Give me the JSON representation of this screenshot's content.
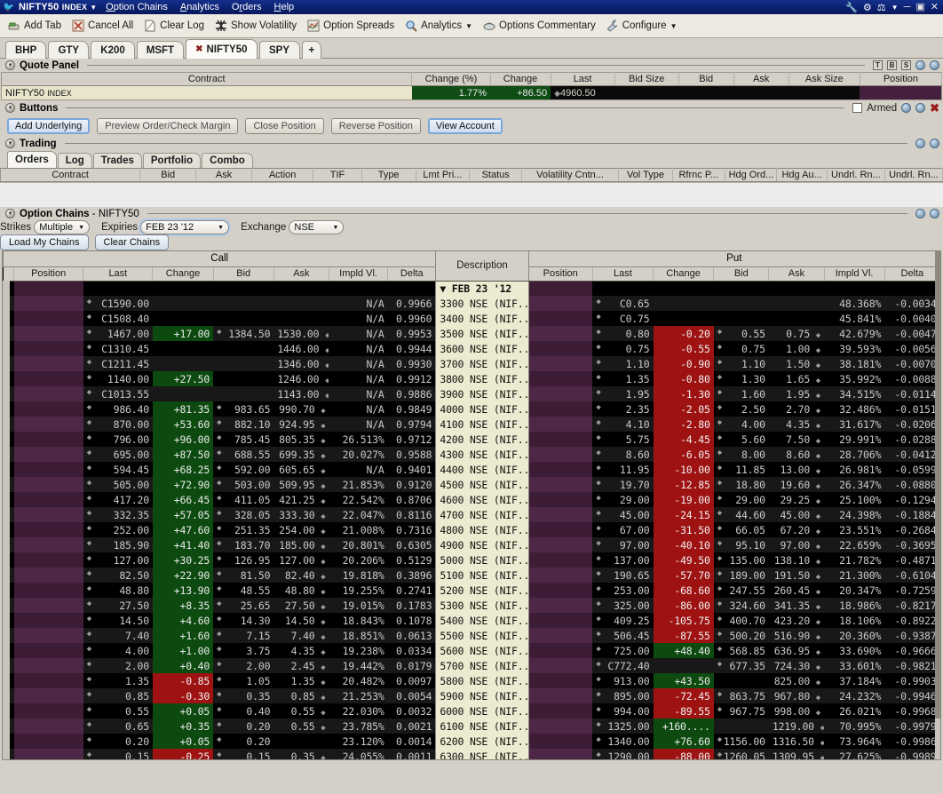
{
  "window": {
    "title_main": "NIFTY50",
    "title_sub": "INDEX",
    "app_icon": "bird-icon",
    "menu": [
      "Option Chains",
      "Analytics",
      "Orders",
      "Help"
    ],
    "right_icons": [
      "wrench-icon",
      "network-icon",
      "pin-icon",
      "chevron-down-icon"
    ],
    "controls": [
      "minimize-button",
      "maximize-button",
      "close-button"
    ]
  },
  "toolbar": {
    "items": [
      {
        "label": "Add Tab",
        "icon": "add-tab-icon"
      },
      {
        "label": "Cancel All",
        "icon": "cancel-all-icon"
      },
      {
        "label": "Clear Log",
        "icon": "clear-log-icon"
      },
      {
        "label": "Show Volatility",
        "icon": "volatility-icon"
      },
      {
        "label": "Option Spreads",
        "icon": "option-spreads-icon"
      },
      {
        "label": "Analytics",
        "icon": "magnifier-icon",
        "dropdown": "▼"
      },
      {
        "label": "Options Commentary",
        "icon": "commentary-icon"
      },
      {
        "label": "Configure",
        "icon": "wrench-icon",
        "dropdown": "▼"
      }
    ]
  },
  "tabs": {
    "items": [
      {
        "label": "BHP",
        "active": false,
        "closable": false
      },
      {
        "label": "GTY",
        "active": false,
        "closable": false
      },
      {
        "label": "K200",
        "active": false,
        "closable": false
      },
      {
        "label": "MSFT",
        "active": false,
        "closable": false
      },
      {
        "label": "NIFTY50",
        "active": true,
        "closable": true,
        "close_glyph": "✖"
      },
      {
        "label": "SPY",
        "active": false,
        "closable": false
      }
    ],
    "add_label": "+"
  },
  "quote_panel": {
    "title": "Quote Panel",
    "right_buttons": [
      "T",
      "B",
      "S"
    ],
    "columns": [
      "Contract",
      "Change (%)",
      "Change",
      "Last",
      "Bid Size",
      "Bid",
      "Ask",
      "Ask Size",
      "Position"
    ],
    "row": {
      "contract": "NIFTY50",
      "contract_suffix": "INDEX",
      "change_pct": "1.77%",
      "change": "+86.50",
      "last": "4960.50",
      "bid_size": "",
      "bid": "",
      "ask": "",
      "ask_size": "",
      "position": ""
    }
  },
  "buttons_panel": {
    "title": "Buttons",
    "buttons": [
      {
        "label": "Add Underlying",
        "state": "focused"
      },
      {
        "label": "Preview Order/Check Margin",
        "state": "disabled"
      },
      {
        "label": "Close Position",
        "state": "disabled"
      },
      {
        "label": "Reverse Position",
        "state": "disabled"
      },
      {
        "label": "View Account",
        "state": "focused"
      }
    ],
    "armed_label": "Armed",
    "armed_checked": false
  },
  "trading_panel": {
    "title": "Trading",
    "tabs": [
      {
        "label": "Orders",
        "active": true
      },
      {
        "label": "Log",
        "active": false
      },
      {
        "label": "Trades",
        "active": false
      },
      {
        "label": "Portfolio",
        "active": false
      },
      {
        "label": "Combo",
        "active": false
      }
    ],
    "columns": [
      "Contract",
      "Bid",
      "Ask",
      "Action",
      "TIF",
      "Type",
      "Lmt Pri...",
      "Status",
      "Volatility Cntn...",
      "Vol Type",
      "Rfrnc P...",
      "Hdg Ord...",
      "Hdg Au...",
      "Undrl. Rn...",
      "Undrl. Rn..."
    ],
    "rows": []
  },
  "option_chains": {
    "title": "Option Chains",
    "title_suffix": "- NIFTY50",
    "controls": {
      "strikes_label": "Strikes",
      "strikes_value": "Multiple",
      "expiries_label": "Expiries",
      "expiries_value": "FEB 23 '12",
      "exchange_label": "Exchange",
      "exchange_value": "NSE",
      "load_chains_label": "Load My Chains",
      "clear_chains_label": "Clear Chains"
    },
    "group_headers": {
      "call": "Call",
      "description": "Description",
      "put": "Put"
    },
    "columns": [
      "Position",
      "Last",
      "Change",
      "Bid",
      "Ask",
      "Impld Vl.",
      "Delta"
    ],
    "expiry_group_row": "FEB 23 '12",
    "rows": [
      {
        "desc": "3300 NSE (NIF...",
        "call": {
          "pos": "",
          "last": "C1590.00",
          "change": "",
          "bid": "",
          "ask": "",
          "iv": "N/A",
          "delta": "0.9966"
        },
        "put": {
          "pos": "",
          "last": "C0.65",
          "change": "",
          "bid": "",
          "ask": "",
          "iv": "48.368%",
          "delta": "-0.0034"
        }
      },
      {
        "desc": "3400 NSE (NIF...",
        "call": {
          "pos": "",
          "last": "C1508.40",
          "change": "",
          "bid": "",
          "ask": "",
          "iv": "N/A",
          "delta": "0.9960"
        },
        "put": {
          "pos": "",
          "last": "C0.75",
          "change": "",
          "bid": "",
          "ask": "",
          "iv": "45.841%",
          "delta": "-0.0040"
        }
      },
      {
        "desc": "3500 NSE (NIF...",
        "call": {
          "pos": "",
          "last": "1467.00",
          "change": "+17.00",
          "bid": "1384.50",
          "ask": "1530.00",
          "iv": "N/A",
          "delta": "0.9953"
        },
        "put": {
          "pos": "",
          "last": "0.80",
          "change": "-0.20",
          "bid": "0.55",
          "ask": "0.75",
          "iv": "42.679%",
          "delta": "-0.0047"
        }
      },
      {
        "desc": "3600 NSE (NIF...",
        "call": {
          "pos": "",
          "last": "C1310.45",
          "change": "",
          "bid": "",
          "ask": "1446.00",
          "iv": "N/A",
          "delta": "0.9944"
        },
        "put": {
          "pos": "",
          "last": "0.75",
          "change": "-0.55",
          "bid": "0.75",
          "ask": "1.00",
          "iv": "39.593%",
          "delta": "-0.0056"
        }
      },
      {
        "desc": "3700 NSE (NIF...",
        "call": {
          "pos": "",
          "last": "C1211.45",
          "change": "",
          "bid": "",
          "ask": "1346.00",
          "iv": "N/A",
          "delta": "0.9930"
        },
        "put": {
          "pos": "",
          "last": "1.10",
          "change": "-0.90",
          "bid": "1.10",
          "ask": "1.50",
          "iv": "38.181%",
          "delta": "-0.0070"
        }
      },
      {
        "desc": "3800 NSE (NIF...",
        "call": {
          "pos": "",
          "last": "1140.00",
          "change": "+27.50",
          "bid": "",
          "ask": "1246.00",
          "iv": "N/A",
          "delta": "0.9912"
        },
        "put": {
          "pos": "",
          "last": "1.35",
          "change": "-0.80",
          "bid": "1.30",
          "ask": "1.65",
          "iv": "35.992%",
          "delta": "-0.0088"
        }
      },
      {
        "desc": "3900 NSE (NIF...",
        "call": {
          "pos": "",
          "last": "C1013.55",
          "change": "",
          "bid": "",
          "ask": "1143.00",
          "iv": "N/A",
          "delta": "0.9886"
        },
        "put": {
          "pos": "",
          "last": "1.95",
          "change": "-1.30",
          "bid": "1.60",
          "ask": "1.95",
          "iv": "34.515%",
          "delta": "-0.0114"
        }
      },
      {
        "desc": "4000 NSE (NIF...",
        "call": {
          "pos": "",
          "last": "986.40",
          "change": "+81.35",
          "bid": "983.65",
          "ask": "990.70",
          "iv": "N/A",
          "delta": "0.9849"
        },
        "put": {
          "pos": "",
          "last": "2.35",
          "change": "-2.05",
          "bid": "2.50",
          "ask": "2.70",
          "iv": "32.486%",
          "delta": "-0.0151"
        }
      },
      {
        "desc": "4100 NSE (NIF...",
        "call": {
          "pos": "",
          "last": "870.00",
          "change": "+53.60",
          "bid": "882.10",
          "ask": "924.95",
          "iv": "N/A",
          "delta": "0.9794"
        },
        "put": {
          "pos": "",
          "last": "4.10",
          "change": "-2.80",
          "bid": "4.00",
          "ask": "4.35",
          "iv": "31.617%",
          "delta": "-0.0206"
        }
      },
      {
        "desc": "4200 NSE (NIF...",
        "call": {
          "pos": "",
          "last": "796.00",
          "change": "+96.00",
          "bid": "785.45",
          "ask": "805.35",
          "iv": "26.513%",
          "delta": "0.9712"
        },
        "put": {
          "pos": "",
          "last": "5.75",
          "change": "-4.45",
          "bid": "5.60",
          "ask": "7.50",
          "iv": "29.991%",
          "delta": "-0.0288"
        }
      },
      {
        "desc": "4300 NSE (NIF...",
        "call": {
          "pos": "",
          "last": "695.00",
          "change": "+87.50",
          "bid": "688.55",
          "ask": "699.35",
          "iv": "20.027%",
          "delta": "0.9588"
        },
        "put": {
          "pos": "",
          "last": "8.60",
          "change": "-6.05",
          "bid": "8.00",
          "ask": "8.60",
          "iv": "28.706%",
          "delta": "-0.0412"
        }
      },
      {
        "desc": "4400 NSE (NIF...",
        "call": {
          "pos": "",
          "last": "594.45",
          "change": "+68.25",
          "bid": "592.00",
          "ask": "605.65",
          "iv": "N/A",
          "delta": "0.9401"
        },
        "put": {
          "pos": "",
          "last": "11.95",
          "change": "-10.00",
          "bid": "11.85",
          "ask": "13.00",
          "iv": "26.981%",
          "delta": "-0.0599"
        }
      },
      {
        "desc": "4500 NSE (NIF...",
        "call": {
          "pos": "",
          "last": "505.00",
          "change": "+72.90",
          "bid": "503.00",
          "ask": "509.95",
          "iv": "21.853%",
          "delta": "0.9120"
        },
        "put": {
          "pos": "",
          "last": "19.70",
          "change": "-12.85",
          "bid": "18.80",
          "ask": "19.60",
          "iv": "26.347%",
          "delta": "-0.0880"
        }
      },
      {
        "desc": "4600 NSE (NIF...",
        "call": {
          "pos": "",
          "last": "417.20",
          "change": "+66.45",
          "bid": "411.05",
          "ask": "421.25",
          "iv": "22.542%",
          "delta": "0.8706"
        },
        "put": {
          "pos": "",
          "last": "29.00",
          "change": "-19.00",
          "bid": "29.00",
          "ask": "29.25",
          "iv": "25.100%",
          "delta": "-0.1294"
        }
      },
      {
        "desc": "4700 NSE (NIF...",
        "call": {
          "pos": "",
          "last": "332.35",
          "change": "+57.05",
          "bid": "328.05",
          "ask": "333.30",
          "iv": "22.047%",
          "delta": "0.8116"
        },
        "put": {
          "pos": "",
          "last": "45.00",
          "change": "-24.15",
          "bid": "44.60",
          "ask": "45.00",
          "iv": "24.398%",
          "delta": "-0.1884"
        }
      },
      {
        "desc": "4800 NSE (NIF...",
        "call": {
          "pos": "",
          "last": "252.00",
          "change": "+47.60",
          "bid": "251.35",
          "ask": "254.00",
          "iv": "21.008%",
          "delta": "0.7316"
        },
        "put": {
          "pos": "",
          "last": "67.00",
          "change": "-31.50",
          "bid": "66.05",
          "ask": "67.20",
          "iv": "23.551%",
          "delta": "-0.2684"
        }
      },
      {
        "desc": "4900 NSE (NIF...",
        "call": {
          "pos": "",
          "last": "185.90",
          "change": "+41.40",
          "bid": "183.70",
          "ask": "185.00",
          "iv": "20.801%",
          "delta": "0.6305"
        },
        "put": {
          "pos": "",
          "last": "97.00",
          "change": "-40.10",
          "bid": "95.10",
          "ask": "97.00",
          "iv": "22.659%",
          "delta": "-0.3695"
        }
      },
      {
        "desc": "5000 NSE (NIF...",
        "call": {
          "pos": "",
          "last": "127.00",
          "change": "+30.25",
          "bid": "126.95",
          "ask": "127.00",
          "iv": "20.206%",
          "delta": "0.5129"
        },
        "put": {
          "pos": "",
          "last": "137.00",
          "change": "-49.50",
          "bid": "135.00",
          "ask": "138.10",
          "iv": "21.782%",
          "delta": "-0.4871"
        }
      },
      {
        "desc": "5100 NSE (NIF...",
        "call": {
          "pos": "",
          "last": "82.50",
          "change": "+22.90",
          "bid": "81.50",
          "ask": "82.40",
          "iv": "19.818%",
          "delta": "0.3896"
        },
        "put": {
          "pos": "",
          "last": "190.65",
          "change": "-57.70",
          "bid": "189.00",
          "ask": "191.50",
          "iv": "21.300%",
          "delta": "-0.6104"
        }
      },
      {
        "desc": "5200 NSE (NIF...",
        "call": {
          "pos": "",
          "last": "48.80",
          "change": "+13.90",
          "bid": "48.55",
          "ask": "48.80",
          "iv": "19.255%",
          "delta": "0.2741"
        },
        "put": {
          "pos": "",
          "last": "253.00",
          "change": "-68.60",
          "bid": "247.55",
          "ask": "260.45",
          "iv": "20.347%",
          "delta": "-0.7259"
        }
      },
      {
        "desc": "5300 NSE (NIF...",
        "call": {
          "pos": "",
          "last": "27.50",
          "change": "+8.35",
          "bid": "25.65",
          "ask": "27.50",
          "iv": "19.015%",
          "delta": "0.1783"
        },
        "put": {
          "pos": "",
          "last": "325.00",
          "change": "-86.00",
          "bid": "324.60",
          "ask": "341.35",
          "iv": "18.986%",
          "delta": "-0.8217"
        }
      },
      {
        "desc": "5400 NSE (NIF...",
        "call": {
          "pos": "",
          "last": "14.50",
          "change": "+4.60",
          "bid": "14.30",
          "ask": "14.50",
          "iv": "18.843%",
          "delta": "0.1078"
        },
        "put": {
          "pos": "",
          "last": "409.25",
          "change": "-105.75",
          "bid": "400.70",
          "ask": "423.20",
          "iv": "18.106%",
          "delta": "-0.8922"
        }
      },
      {
        "desc": "5500 NSE (NIF...",
        "call": {
          "pos": "",
          "last": "7.40",
          "change": "+1.60",
          "bid": "7.15",
          "ask": "7.40",
          "iv": "18.851%",
          "delta": "0.0613"
        },
        "put": {
          "pos": "",
          "last": "506.45",
          "change": "-87.55",
          "bid": "500.20",
          "ask": "516.90",
          "iv": "20.360%",
          "delta": "-0.9387"
        }
      },
      {
        "desc": "5600 NSE (NIF...",
        "call": {
          "pos": "",
          "last": "4.00",
          "change": "+1.00",
          "bid": "3.75",
          "ask": "4.35",
          "iv": "19.238%",
          "delta": "0.0334"
        },
        "put": {
          "pos": "",
          "last": "725.00",
          "change": "+48.40",
          "bid": "568.85",
          "ask": "636.95",
          "iv": "33.690%",
          "delta": "-0.9666"
        }
      },
      {
        "desc": "5700 NSE (NIF...",
        "call": {
          "pos": "",
          "last": "2.00",
          "change": "+0.40",
          "bid": "2.00",
          "ask": "2.45",
          "iv": "19.442%",
          "delta": "0.0179"
        },
        "put": {
          "pos": "",
          "last": "C772.40",
          "change": "",
          "bid": "677.35",
          "ask": "724.30",
          "iv": "33.601%",
          "delta": "-0.9821"
        }
      },
      {
        "desc": "5800 NSE (NIF...",
        "call": {
          "pos": "",
          "last": "1.35",
          "change": "-0.85",
          "bid": "1.05",
          "ask": "1.35",
          "iv": "20.482%",
          "delta": "0.0097"
        },
        "put": {
          "pos": "",
          "last": "913.00",
          "change": "+43.50",
          "bid": "",
          "ask": "825.00",
          "iv": "37.184%",
          "delta": "-0.9903"
        }
      },
      {
        "desc": "5900 NSE (NIF...",
        "call": {
          "pos": "",
          "last": "0.85",
          "change": "-0.30",
          "bid": "0.35",
          "ask": "0.85",
          "iv": "21.253%",
          "delta": "0.0054"
        },
        "put": {
          "pos": "",
          "last": "895.00",
          "change": "-72.45",
          "bid": "863.75",
          "ask": "967.80",
          "iv": "24.232%",
          "delta": "-0.9946"
        }
      },
      {
        "desc": "6000 NSE (NIF...",
        "call": {
          "pos": "",
          "last": "0.55",
          "change": "+0.05",
          "bid": "0.40",
          "ask": "0.55",
          "iv": "22.030%",
          "delta": "0.0032"
        },
        "put": {
          "pos": "",
          "last": "994.00",
          "change": "-89.55",
          "bid": "967.75",
          "ask": "998.00",
          "iv": "26.021%",
          "delta": "-0.9968"
        }
      },
      {
        "desc": "6100 NSE (NIF...",
        "call": {
          "pos": "",
          "last": "0.65",
          "change": "+0.35",
          "bid": "0.20",
          "ask": "0.55",
          "iv": "23.785%",
          "delta": "0.0021"
        },
        "put": {
          "pos": "",
          "last": "1325.00",
          "change": "+160....",
          "bid": "",
          "ask": "1219.00",
          "iv": "70.995%",
          "delta": "-0.9979"
        }
      },
      {
        "desc": "6200 NSE (NIF...",
        "call": {
          "pos": "",
          "last": "0.20",
          "change": "+0.05",
          "bid": "0.20",
          "ask": "",
          "iv": "23.120%",
          "delta": "0.0014"
        },
        "put": {
          "pos": "",
          "last": "1340.00",
          "change": "+76.60",
          "bid": "1156.00",
          "ask": "1316.50",
          "iv": "73.964%",
          "delta": "-0.9986"
        }
      },
      {
        "desc": "6300 NSE (NIF...",
        "call": {
          "pos": "",
          "last": "0.15",
          "change": "-0.25",
          "bid": "0.15",
          "ask": "0.35",
          "iv": "24.055%",
          "delta": "0.0011"
        },
        "put": {
          "pos": "",
          "last": "1290.00",
          "change": "-88.00",
          "bid": "1260.05",
          "ask": "1309.95",
          "iv": "27.625%",
          "delta": "-0.9989"
        }
      }
    ]
  },
  "colors": {
    "up": "#0c4a10",
    "down": "#9e1212",
    "position_band": "#45203e",
    "description_bg": "#edead2",
    "titlebar": "#0a1f6e",
    "chrome": "#d4d0c8"
  }
}
